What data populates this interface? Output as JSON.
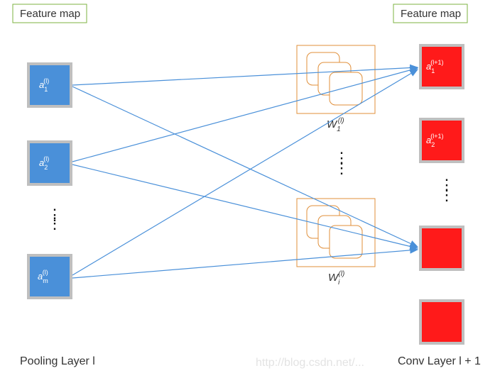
{
  "titles": {
    "left": "Feature map",
    "right": "Feature map"
  },
  "layers": {
    "left": "Pooling Layer l",
    "right": "Conv Layer l + 1"
  },
  "left_nodes": [
    "a_1^(l)",
    "a_2^(l)",
    "a_m^(l)"
  ],
  "right_nodes": [
    "a_1^(l+1)",
    "a_2^(l+1)",
    "",
    ""
  ],
  "kernels": [
    "W_1^(l)",
    "W_i^(l)"
  ],
  "colors": {
    "blue": "#4a90d9",
    "red": "#ff1a1a",
    "kernel": "#e08f3a",
    "titleBorder": "#7cb342"
  },
  "ellipsis": "⋮",
  "watermark": "http://blog.csdn.net/..."
}
